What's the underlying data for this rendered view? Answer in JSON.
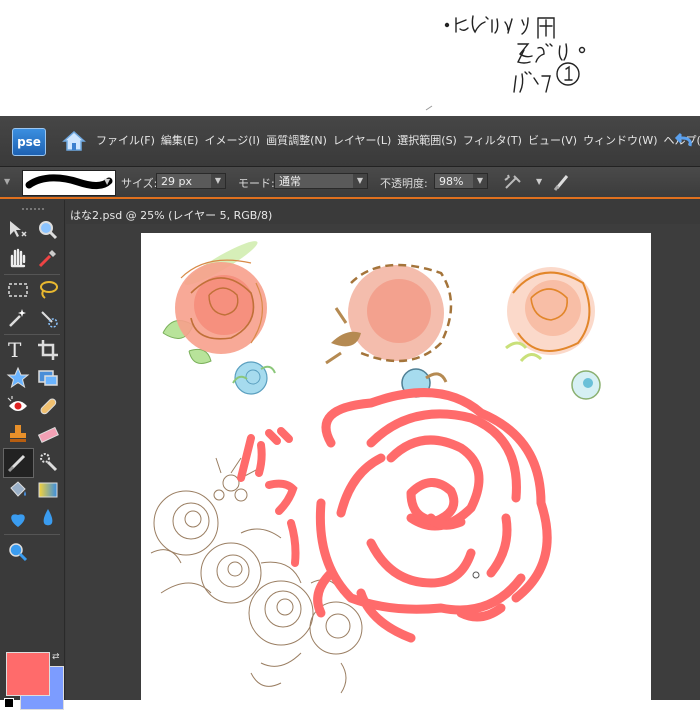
{
  "note": {
    "handwritten_lines": [
      "・ヒベリンツナ用",
      "そざい。",
      "バラ①"
    ]
  },
  "app": {
    "logo": "pse",
    "menu": [
      "ファイル(F)",
      "編集(E)",
      "イメージ(I)",
      "画質調整(N)",
      "レイヤー(L)",
      "選択範囲(S)",
      "フィルタ(T)",
      "ビュー(V)",
      "ウィンドウ(W)",
      "ヘルプ(H)"
    ],
    "options": {
      "size_label": "サイズ:",
      "size_value": "29 px",
      "mode_label": "モード:",
      "mode_value": "通常",
      "opacity_label": "不透明度:",
      "opacity_value": "98%"
    },
    "document": {
      "title": "はな2.psd @ 25% (レイヤー 5, RGB/8)"
    },
    "colors": {
      "foreground": "#ff6b6b",
      "background": "#7c9cff",
      "accent_line": "#e0701e"
    },
    "icons": [
      "home-icon",
      "undo-icon",
      "brush-icon",
      "airbrush-icon",
      "move-tool-icon",
      "zoom-tool-icon",
      "hand-tool-icon",
      "eyedropper-icon",
      "marquee-icon",
      "lasso-icon",
      "magic-wand-icon",
      "quick-selection-icon",
      "type-tool-icon",
      "crop-tool-icon",
      "shape-tool-icon",
      "recompose-icon",
      "red-eye-icon",
      "healing-brush-icon",
      "clone-stamp-icon",
      "eraser-icon",
      "brush-tool-icon",
      "smart-brush-icon",
      "paint-bucket-icon",
      "gradient-icon",
      "blur-drop-icon",
      "sharpen-drop-icon",
      "sponge-icon"
    ]
  }
}
